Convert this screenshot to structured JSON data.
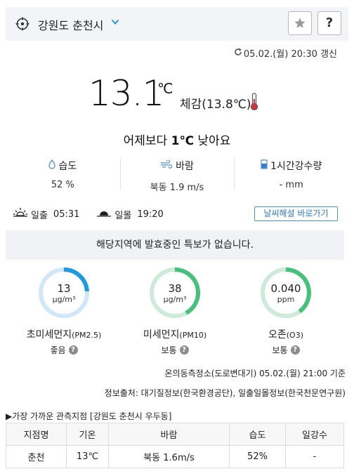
{
  "header": {
    "location": "강원도 춘천시",
    "location_icon": "target-icon",
    "chevron_icon": "chevron-down-icon",
    "favorite_icon": "star-icon",
    "help_label": "?"
  },
  "updated": "05.02.(월) 20:30 갱신",
  "current": {
    "temp": "13.1",
    "unit": "℃",
    "feels_like": "체감(13.8℃)",
    "compare_prefix": "어제보다 ",
    "compare_value": "1℃",
    "compare_suffix": " 낮아요"
  },
  "stats": [
    {
      "label": "습도",
      "value": "52 %",
      "icon": "droplet-icon"
    },
    {
      "label": "바람",
      "value": "북동 1.9 m/s",
      "icon": "wind-icon"
    },
    {
      "label": "1시간강수량",
      "value": "- mm",
      "icon": "rain-gauge-icon"
    }
  ],
  "sun": {
    "sunrise_label": "일출",
    "sunrise_time": "05:31",
    "sunset_label": "일몰",
    "sunset_time": "19:20",
    "guide_button": "날씨해설 바로가기"
  },
  "alert": "해당지역에 발효중인 특보가 없습니다.",
  "air": [
    {
      "value": "13",
      "unit": "μg/m³",
      "name": "초미세먼지",
      "sub": "(PM2.5)",
      "status": "좋음",
      "level": 0.24,
      "color": "#1e9be0",
      "track": "#cfe7f6"
    },
    {
      "value": "38",
      "unit": "μg/m³",
      "name": "미세먼지",
      "sub": "(PM10)",
      "status": "보통",
      "level": 0.42,
      "color": "#46c07a",
      "track": "#cdebd8"
    },
    {
      "value": "0.040",
      "unit": "ppm",
      "name": "오존",
      "sub": "(O3)",
      "status": "보통",
      "level": 0.4,
      "color": "#46c07a",
      "track": "#cdebd8"
    }
  ],
  "measure": "온의동측정소(도로변대기) 05.02.(월) 21:00 기준",
  "source": "정보출처: 대기질정보(한국환경공단), 일출일몰정보(한국천문연구원)",
  "nearest": {
    "title": "▶가장 가까운 관측지점 [강원도 춘천시 우두동]",
    "headers": [
      "지점명",
      "기온",
      "바람",
      "습도",
      "일강수"
    ],
    "row": [
      "춘천",
      "13℃",
      "북동 1.6m/s",
      "52%",
      "-"
    ]
  }
}
